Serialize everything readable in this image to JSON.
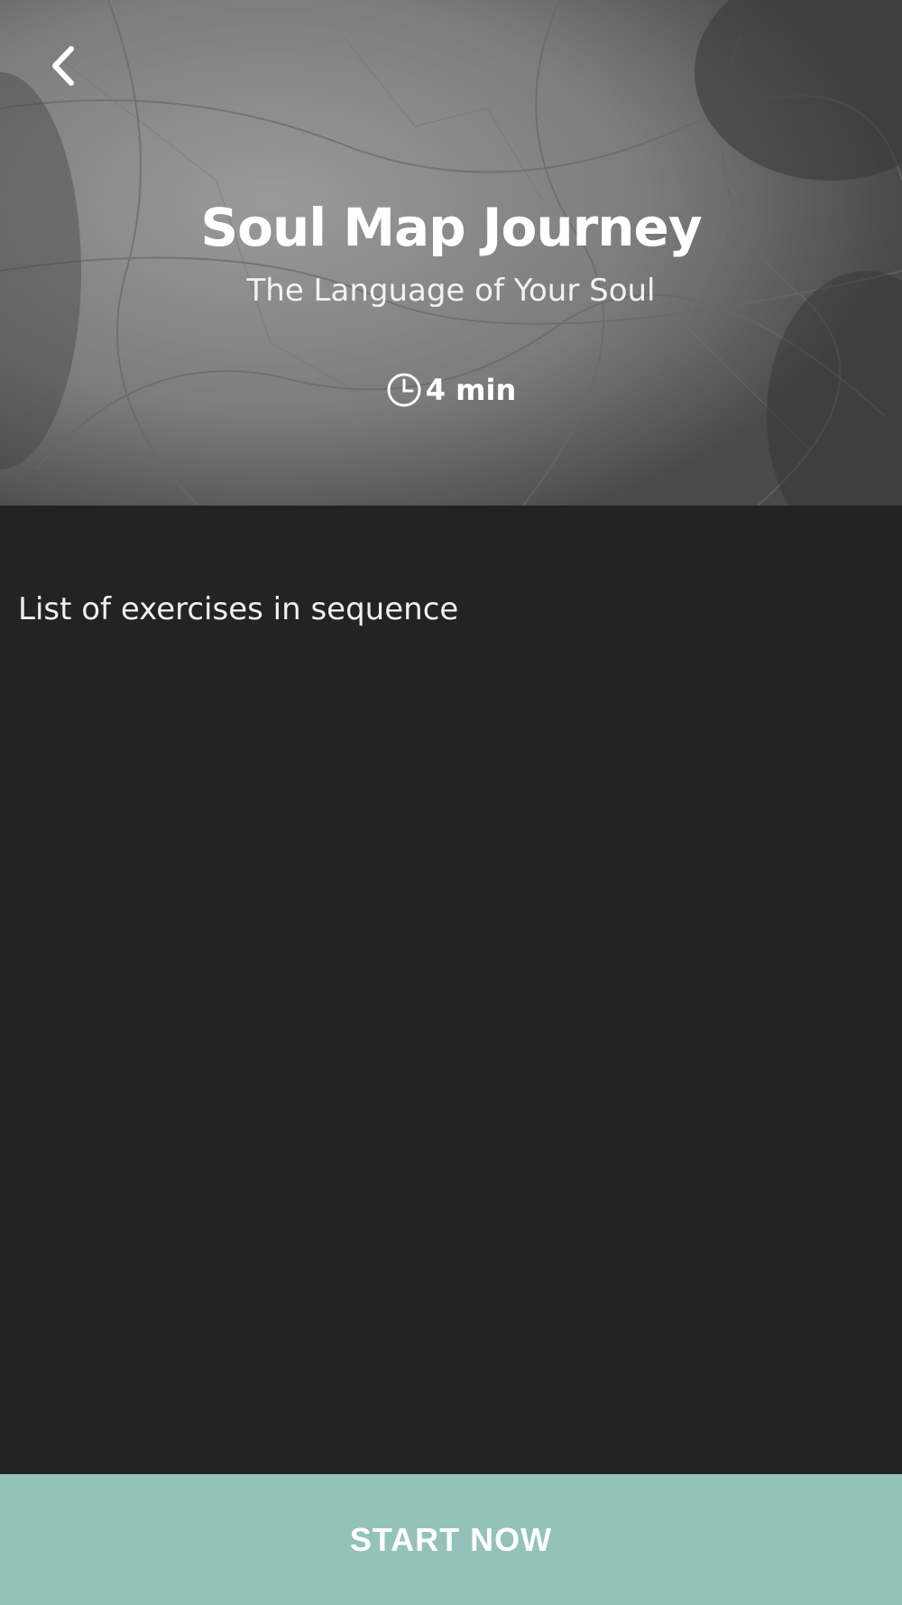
{
  "header": {
    "back_icon": "chevron-left-icon",
    "title": "Soul Map Journey",
    "subtitle": "The Language of Your Soul",
    "duration_icon": "clock-icon",
    "duration": "4 min"
  },
  "main": {
    "section_heading": "List of exercises in sequence"
  },
  "footer": {
    "start_label": "START NOW"
  },
  "colors": {
    "background": "#232323",
    "accent": "#94c2ba",
    "text": "#ffffff"
  }
}
